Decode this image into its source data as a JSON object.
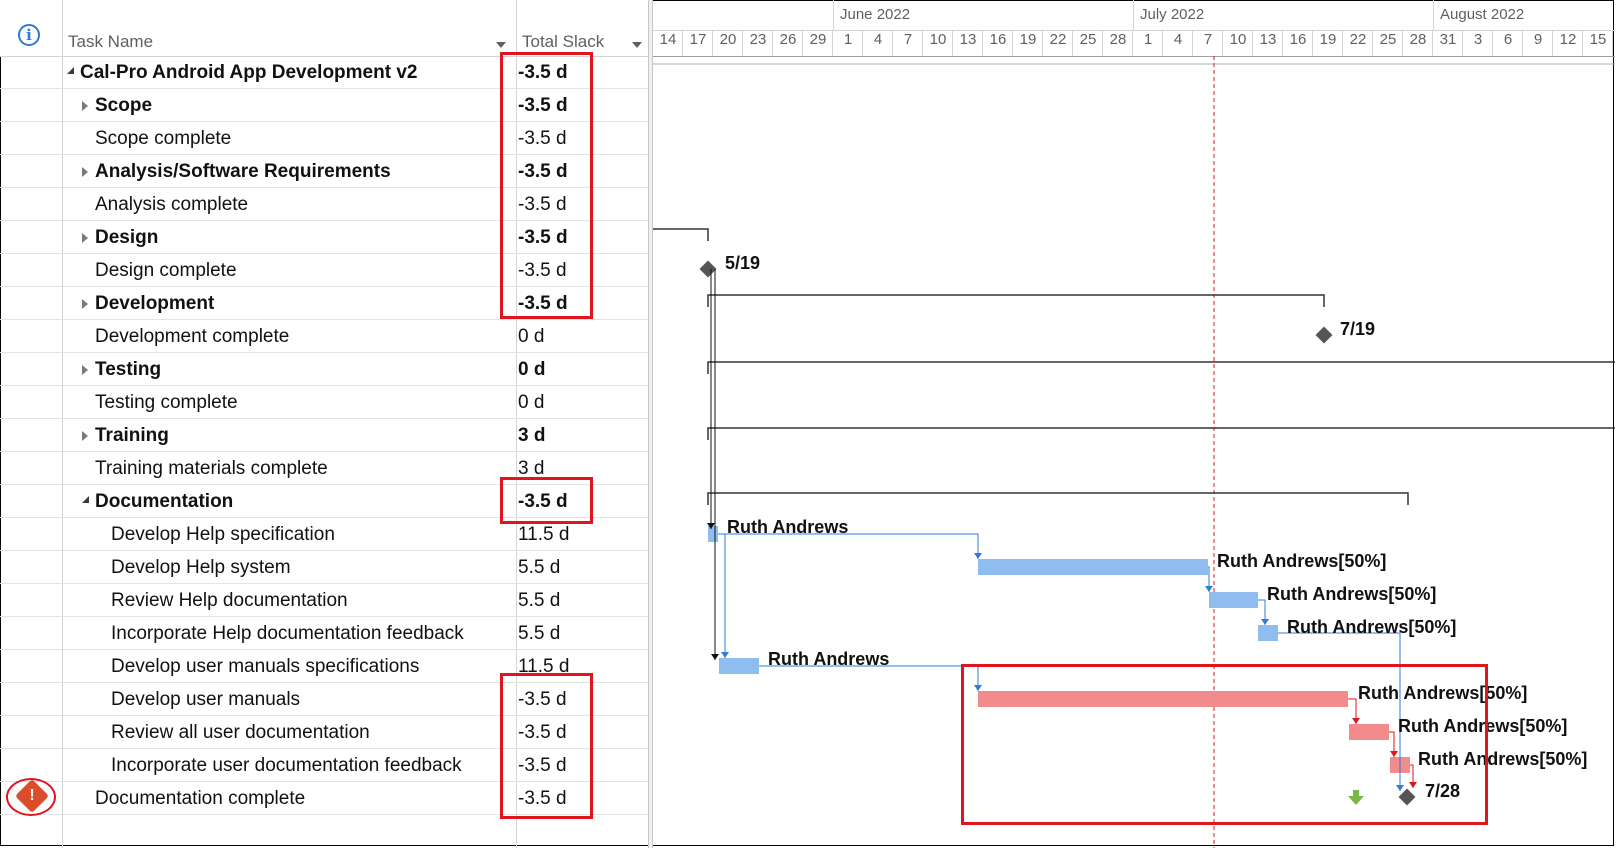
{
  "columns": {
    "task_name": "Task Name",
    "total_slack": "Total Slack"
  },
  "tasks": [
    {
      "name": "Cal-Pro Android App Development v2",
      "slack": "-3.5 d",
      "bold": true,
      "level": 0,
      "toggle": "down"
    },
    {
      "name": "Scope",
      "slack": "-3.5 d",
      "bold": true,
      "level": 1,
      "toggle": "right"
    },
    {
      "name": "Scope complete",
      "slack": "-3.5 d",
      "bold": false,
      "level": 1,
      "toggle": "none"
    },
    {
      "name": "Analysis/Software Requirements",
      "slack": "-3.5 d",
      "bold": true,
      "level": 1,
      "toggle": "right"
    },
    {
      "name": "Analysis complete",
      "slack": "-3.5 d",
      "bold": false,
      "level": 1,
      "toggle": "none"
    },
    {
      "name": "Design",
      "slack": "-3.5 d",
      "bold": true,
      "level": 1,
      "toggle": "right"
    },
    {
      "name": "Design complete",
      "slack": "-3.5 d",
      "bold": false,
      "level": 1,
      "toggle": "none"
    },
    {
      "name": "Development",
      "slack": "-3.5 d",
      "bold": true,
      "level": 1,
      "toggle": "right"
    },
    {
      "name": "Development complete",
      "slack": "0 d",
      "bold": false,
      "level": 1,
      "toggle": "none"
    },
    {
      "name": "Testing",
      "slack": "0 d",
      "bold": true,
      "level": 1,
      "toggle": "right"
    },
    {
      "name": "Testing complete",
      "slack": "0 d",
      "bold": false,
      "level": 1,
      "toggle": "none"
    },
    {
      "name": "Training",
      "slack": "3 d",
      "bold": true,
      "level": 1,
      "toggle": "right"
    },
    {
      "name": "Training materials complete",
      "slack": "3 d",
      "bold": false,
      "level": 1,
      "toggle": "none"
    },
    {
      "name": "Documentation",
      "slack": "-3.5 d",
      "bold": true,
      "level": 1,
      "toggle": "down"
    },
    {
      "name": "Develop Help specification",
      "slack": "11.5 d",
      "bold": false,
      "level": 2,
      "toggle": "none"
    },
    {
      "name": "Develop Help system",
      "slack": "5.5 d",
      "bold": false,
      "level": 2,
      "toggle": "none"
    },
    {
      "name": "Review Help documentation",
      "slack": "5.5 d",
      "bold": false,
      "level": 2,
      "toggle": "none"
    },
    {
      "name": "Incorporate Help documentation feedback",
      "slack": "5.5 d",
      "bold": false,
      "level": 2,
      "toggle": "none"
    },
    {
      "name": "Develop user manuals specifications",
      "slack": "11.5 d",
      "bold": false,
      "level": 2,
      "toggle": "none"
    },
    {
      "name": "Develop user manuals",
      "slack": "-3.5 d",
      "bold": false,
      "level": 2,
      "toggle": "none"
    },
    {
      "name": "Review all user documentation",
      "slack": "-3.5 d",
      "bold": false,
      "level": 2,
      "toggle": "none"
    },
    {
      "name": "Incorporate user documentation feedback",
      "slack": "-3.5 d",
      "bold": false,
      "level": 2,
      "toggle": "none"
    },
    {
      "name": "Documentation complete",
      "slack": "-3.5 d",
      "bold": false,
      "level": 1,
      "toggle": "none"
    }
  ],
  "timescale": {
    "months": [
      "June 2022",
      "July 2022",
      "August 2022"
    ],
    "days": [
      "14",
      "17",
      "20",
      "23",
      "26",
      "29",
      "1",
      "4",
      "7",
      "10",
      "13",
      "16",
      "19",
      "22",
      "25",
      "28",
      "1",
      "4",
      "7",
      "10",
      "13",
      "16",
      "19",
      "22",
      "25",
      "28",
      "31",
      "3",
      "6",
      "9",
      "12",
      "15"
    ]
  },
  "gantt_labels": {
    "design_complete": "5/19",
    "development_complete": "7/19",
    "documentation_complete": "7/28",
    "help_spec": "Ruth Andrews",
    "help_system": "Ruth Andrews[50%]",
    "review_help": "Ruth Andrews[50%]",
    "incorporate_help": "Ruth Andrews[50%]",
    "manuals_spec": "Ruth Andrews",
    "manuals": "Ruth Andrews[50%]",
    "review_all": "Ruth Andrews[50%]",
    "incorporate_user": "Ruth Andrews[50%]"
  },
  "indicators": {
    "header_icon": "info-icon",
    "row_23_icon": "warning-icon"
  },
  "colors": {
    "bar_normal": "#8fbdf0",
    "bar_critical": "#f28b8b",
    "highlight": "#e0161f",
    "status_date": "#e0161f",
    "arrow_blue": "#2e7bd8",
    "milestone": "#555555"
  }
}
